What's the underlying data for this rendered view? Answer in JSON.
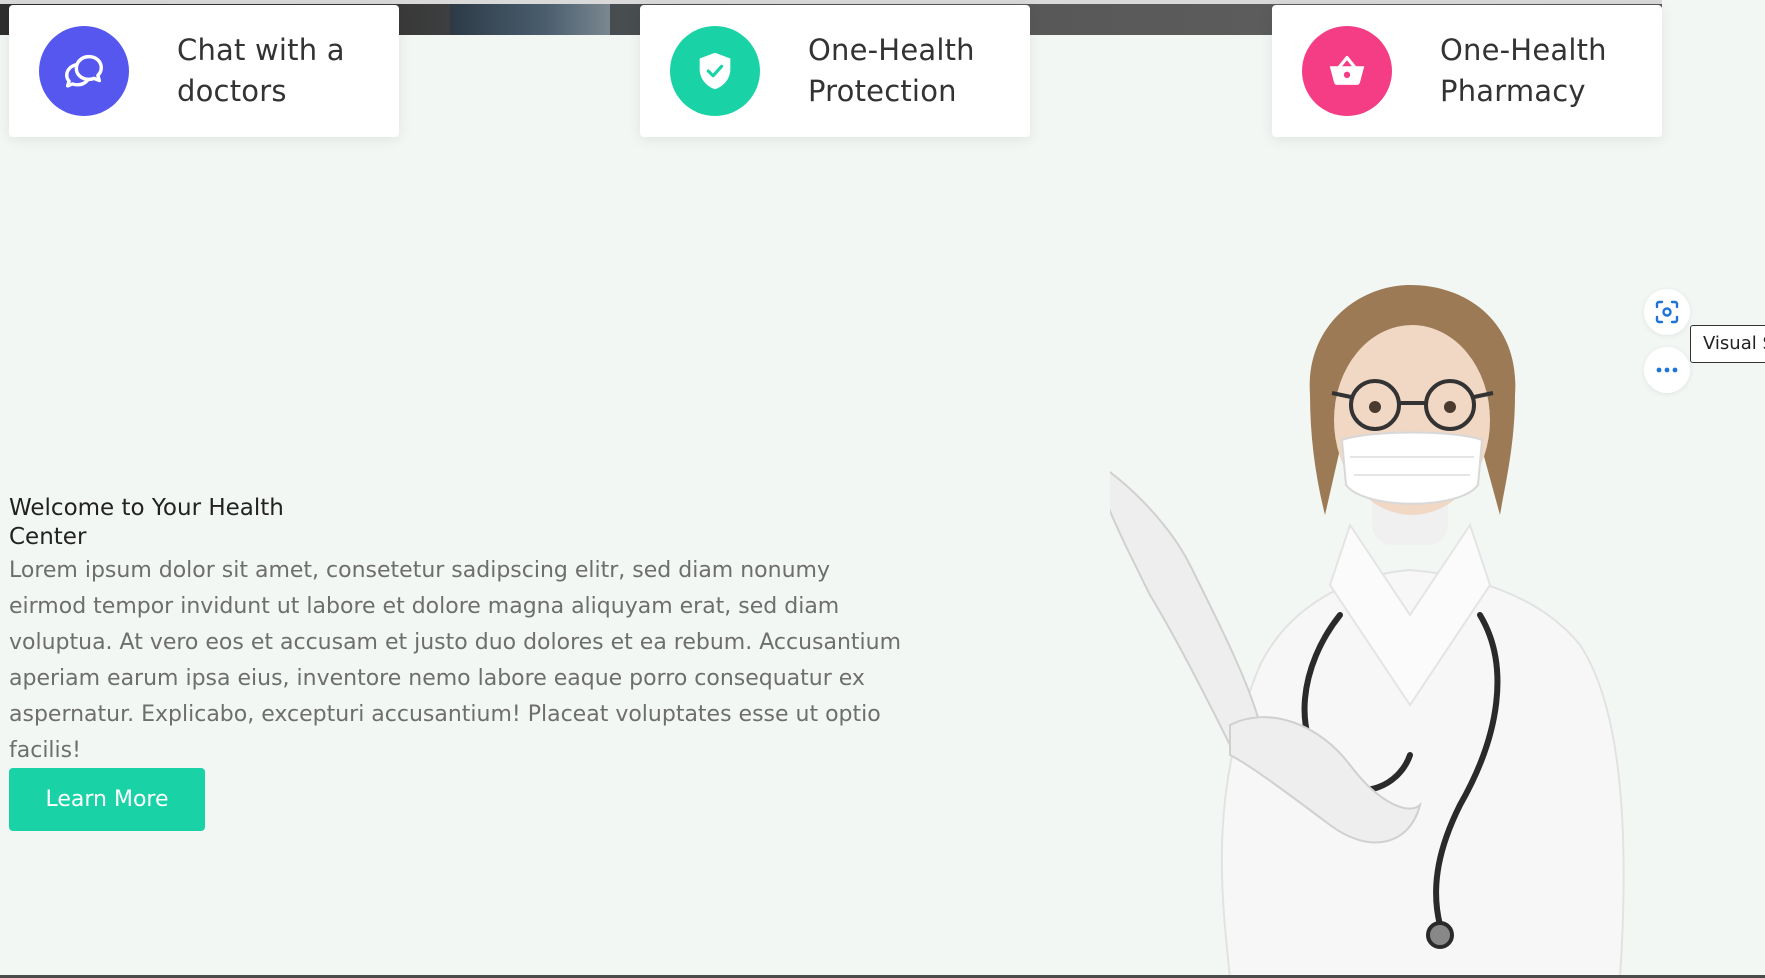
{
  "cards": [
    {
      "title": "Chat with a doctors",
      "icon": "chat-bubbles-icon",
      "color": "#5557ee"
    },
    {
      "title": "One-Health Protection",
      "icon": "shield-check-icon",
      "color": "#19d3a6"
    },
    {
      "title": "One-Health Pharmacy",
      "icon": "shopping-basket-icon",
      "color": "#f53d86"
    }
  ],
  "hero": {
    "welcome": "Welcome to Your Health Center",
    "body": "Lorem ipsum dolor sit amet, consetetur sadipscing elitr, sed diam nonumy eirmod tempor invidunt ut labore et dolore magna aliquyam erat, sed diam voluptua. At vero eos et accusam et justo duo dolores et ea rebum. Accusantium aperiam earum ipsa eius, inventore nemo labore eaque porro consequatur ex aspernatur. Explicabo, excepturi accusantium! Placeat voluptates esse ut optio facilis!",
    "button_label": "Learn More",
    "button_color": "#19d3a6"
  },
  "visual_search": {
    "tooltip": "Visual Search",
    "scan_icon": "visual-search-icon",
    "more_icon": "more-options-icon",
    "accent": "#1f73d6"
  }
}
